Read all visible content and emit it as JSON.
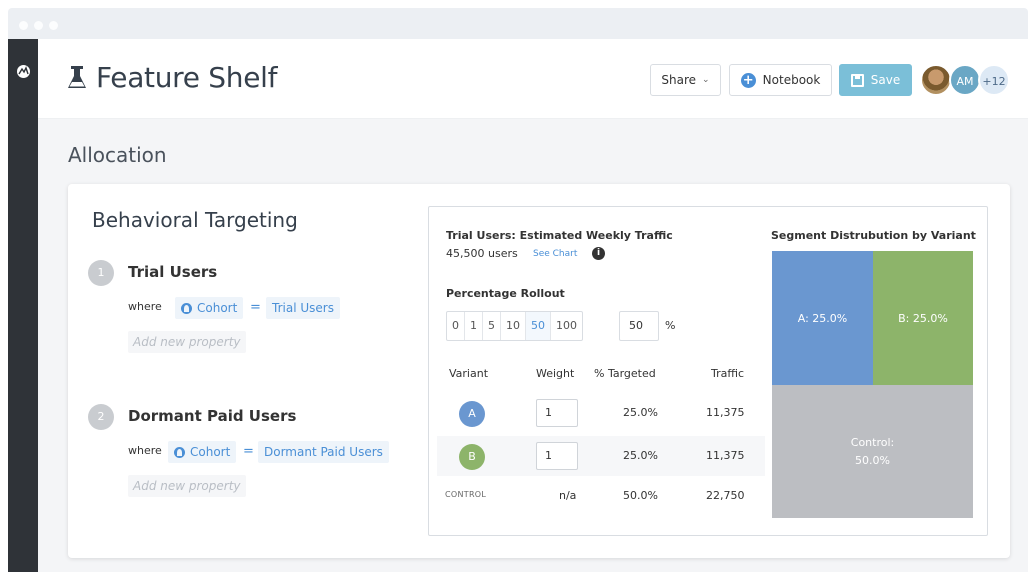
{
  "app": {
    "title": "Feature Shelf",
    "share_label": "Share",
    "notebook_label": "Notebook",
    "save_label": "Save",
    "avatar_initials": "AM",
    "avatar_more": "+12"
  },
  "allocation": {
    "section_title": "Allocation",
    "card_title": "Behavioral Targeting",
    "segments": [
      {
        "number": "1",
        "name": "Trial Users",
        "where_label": "where",
        "property": "Cohort",
        "operator": "=",
        "value": "Trial Users",
        "add_placeholder": "Add new property"
      },
      {
        "number": "2",
        "name": "Dormant Paid Users",
        "where_label": "where",
        "property": "Cohort",
        "operator": "=",
        "value": "Dormant Paid Users",
        "add_placeholder": "Add new property"
      }
    ]
  },
  "traffic": {
    "title": "Trial Users: Estimated Weekly Traffic",
    "users": "45,500 users",
    "see_chart": "See Chart",
    "info_icon": "i",
    "rollout_label": "Percentage Rollout",
    "rollout_options": [
      "0",
      "1",
      "5",
      "10",
      "50",
      "100"
    ],
    "rollout_selected": "50",
    "rollout_value": "50",
    "percent_sign": "%",
    "headers": {
      "variant": "Variant",
      "weight": "Weight",
      "targeted": "% Targeted",
      "traffic": "Traffic"
    },
    "rows": [
      {
        "variant": "A",
        "weight": "1",
        "targeted": "25.0%",
        "traffic": "11,375",
        "color": "#6a97d0"
      },
      {
        "variant": "B",
        "weight": "1",
        "targeted": "25.0%",
        "traffic": "11,375",
        "color": "#8db46a"
      },
      {
        "variant": "CONTROL",
        "weight": "n/a",
        "targeted": "50.0%",
        "traffic": "22,750"
      }
    ]
  },
  "distribution": {
    "title": "Segment Distrubution by Variant",
    "blocks": [
      {
        "label": "A: 25.0%",
        "share": 0.25,
        "color": "#6a97d0"
      },
      {
        "label": "B: 25.0%",
        "share": 0.25,
        "color": "#8db46a"
      },
      {
        "label_line1": "Control:",
        "label_line2": "50.0%",
        "share": 0.5,
        "color": "#bcbec2"
      }
    ]
  }
}
